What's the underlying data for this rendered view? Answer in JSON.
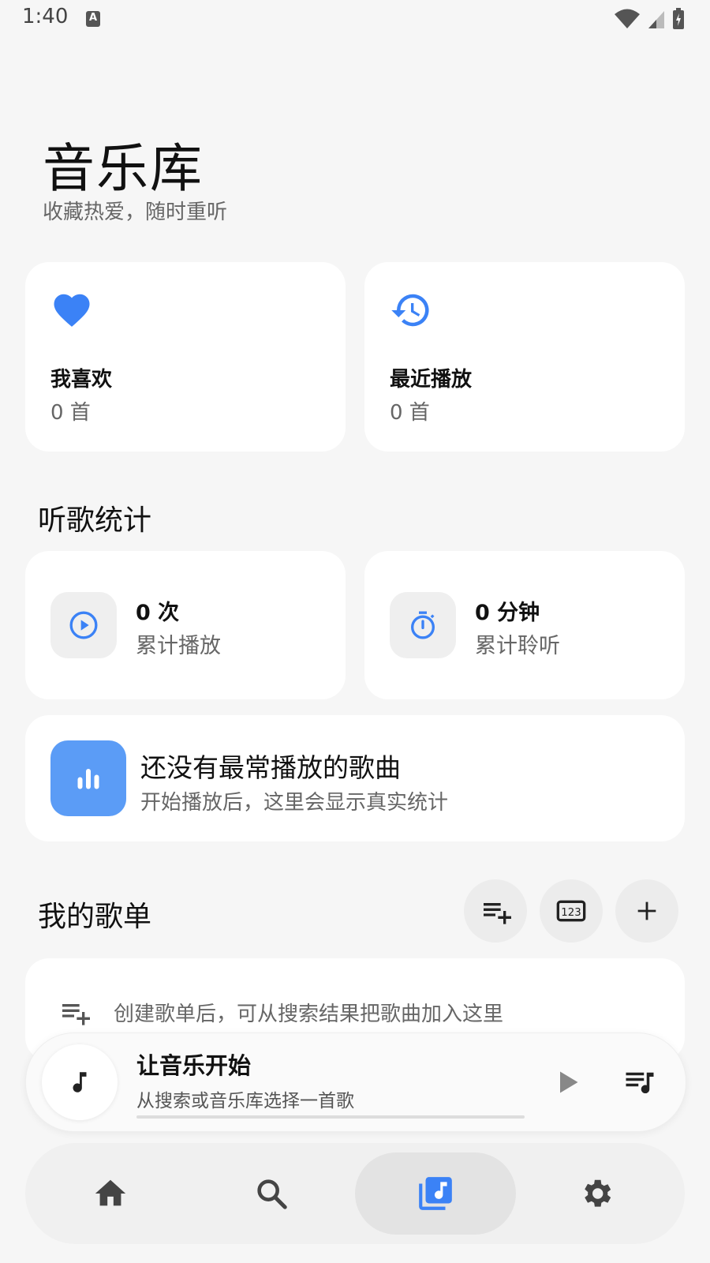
{
  "status_bar": {
    "time": "1:40",
    "notification_icon": "text-a-icon"
  },
  "header": {
    "title": "音乐库",
    "subtitle": "收藏热爱，随时重听"
  },
  "quick_cards": [
    {
      "name": "我喜欢",
      "count": "0 首",
      "icon": "heart-icon"
    },
    {
      "name": "最近播放",
      "count": "0 首",
      "icon": "history-icon"
    }
  ],
  "stats": {
    "section_title": "听歌统计",
    "plays": {
      "value": "0 次",
      "label": "累计播放"
    },
    "minutes": {
      "value": "0 分钟",
      "label": "累计聆听"
    }
  },
  "top_song": {
    "title": "还没有最常播放的歌曲",
    "subtitle": "开始播放后，这里会显示真实统计"
  },
  "playlists": {
    "section_title": "我的歌单",
    "empty_hint": "创建歌单后，可从搜索结果把歌曲加入这里",
    "actions": [
      "playlist-add-icon",
      "numbered-sort-icon",
      "plus-icon"
    ]
  },
  "player": {
    "title": "让音乐开始",
    "subtitle": "从搜索或音乐库选择一首歌",
    "progress": 0
  },
  "nav": {
    "items": [
      "home",
      "search",
      "library",
      "settings"
    ],
    "selected": "library"
  },
  "colors": {
    "accent": "#3b82f6",
    "accent_light": "#5b9cf6",
    "background": "#f6f6f6"
  }
}
